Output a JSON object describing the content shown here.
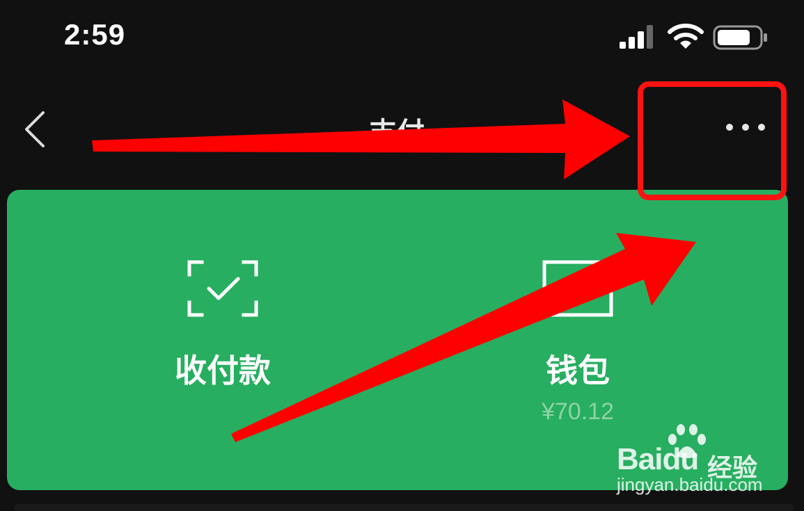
{
  "status_bar": {
    "time": "2:59",
    "icons": [
      "signal-icon",
      "wifi-icon",
      "battery-icon"
    ]
  },
  "nav": {
    "title": "支付",
    "back_icon": "chevron-left-icon",
    "more_icon": "more-dots-icon"
  },
  "pay_card": {
    "background": "#27ae60",
    "items": [
      {
        "label": "收付款",
        "icon": "scan-check-icon"
      },
      {
        "label": "钱包",
        "icon": "wallet-icon",
        "balance": "¥70.12"
      }
    ]
  },
  "annotations": {
    "color": "#ff0000",
    "highlight_box": "more-button",
    "arrows": 2
  },
  "watermark": {
    "brand": "Bai",
    "brand_suffix": "du",
    "tag": "经验",
    "url": "jingyan.baidu.com"
  }
}
